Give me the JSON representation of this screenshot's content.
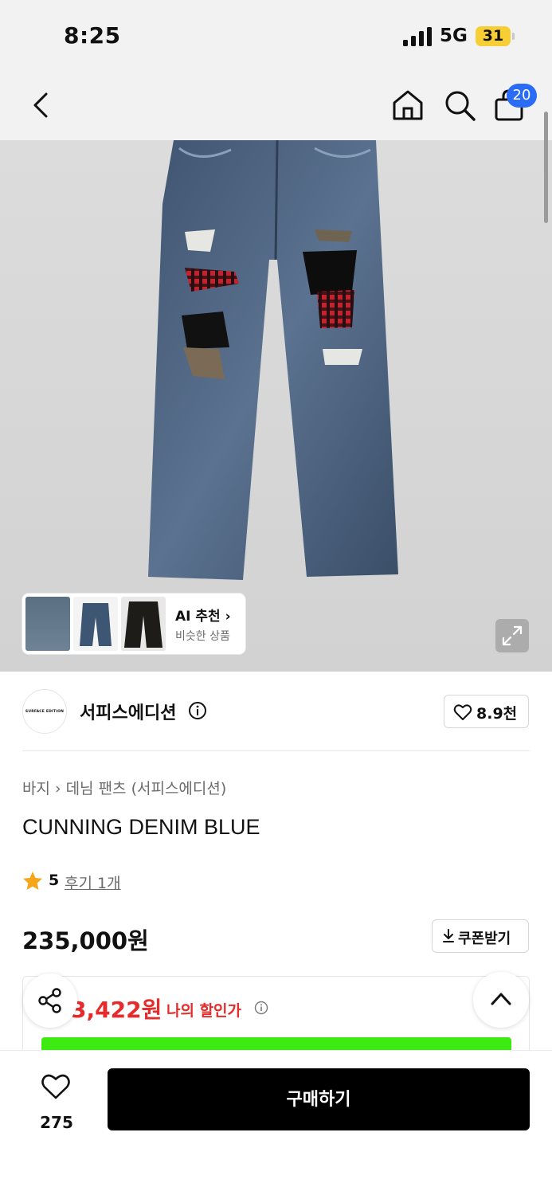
{
  "status_bar": {
    "time": "8:25",
    "network": "5G",
    "battery": "31"
  },
  "nav": {
    "cart_count": "20",
    "icons": [
      "back-icon",
      "home-icon",
      "search-icon",
      "cart-icon"
    ]
  },
  "gallery": {
    "ai_recommend": {
      "title": "AI 추천",
      "subtitle": "비슷한 상품"
    },
    "expand_icon": "expand-icon"
  },
  "brand": {
    "logo_text": "SURFACE EDITION",
    "name": "서피스에디션",
    "likes": "8.9천"
  },
  "breadcrumb": {
    "category": "바지",
    "subcategory": "데님 팬츠 (서피스에디션)"
  },
  "product": {
    "name": "CUNNING DENIM BLUE",
    "rating": "5",
    "reviews": "후기 1개",
    "price": "235,000원",
    "coupon_label": "쿠폰받기",
    "my_price": "3,422원",
    "my_price_label": "나의 할인가"
  },
  "bottom_bar": {
    "wish_count": "275",
    "buy_label": "구매하기"
  },
  "colors": {
    "accent_red": "#e52b2b",
    "badge_blue": "#2a6cf6",
    "battery_yellow": "#f7ce34",
    "banner_green": "#3dea11"
  }
}
